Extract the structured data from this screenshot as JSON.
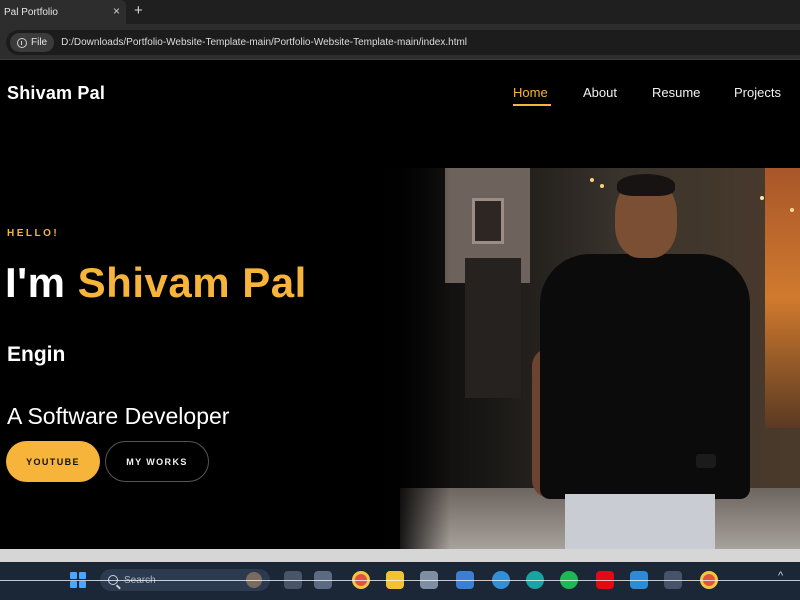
{
  "browser": {
    "tab_title": "Pal Portfolio",
    "tab_close": "×",
    "new_tab": "+",
    "file_chip": "File",
    "url": "D:/Downloads/Portfolio-Website-Template-main/Portfolio-Website-Template-main/index.html"
  },
  "site": {
    "brand": "Shivam Pal",
    "nav": [
      {
        "label": "Home",
        "active": true
      },
      {
        "label": "About"
      },
      {
        "label": "Resume"
      },
      {
        "label": "Projects"
      }
    ],
    "hero": {
      "greeting": "HELLO!",
      "headline_prefix": "I'm ",
      "headline_name": "Shivam Pal",
      "typed_text": "Engin",
      "role": "A Software Developer",
      "buttons": {
        "youtube": "YOUTUBE",
        "works": "MY WORKS"
      }
    },
    "accent_color": "#f6b43a"
  },
  "taskbar": {
    "search_placeholder": "Search",
    "apps": [
      "widgets-icon",
      "taskview-icon",
      "store-icon",
      "chrome-icon",
      "file-explorer-icon",
      "calculator-icon",
      "photos-icon",
      "edge-icon",
      "spotify-icon",
      "netflix-icon",
      "vscode-icon",
      "extra-icon",
      "chrome-icon"
    ]
  }
}
